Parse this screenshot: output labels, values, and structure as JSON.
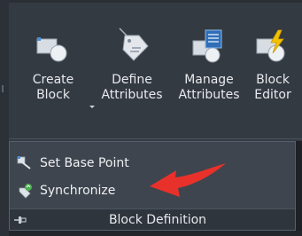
{
  "ribbon": {
    "tools": [
      {
        "line1": "Create",
        "line2": "Block",
        "icon": "create-block-icon"
      },
      {
        "line1": "Define",
        "line2": "Attributes",
        "icon": "define-attributes-icon"
      },
      {
        "line1": "Manage",
        "line2": "Attributes",
        "icon": "manage-attributes-icon"
      },
      {
        "line1": "Block",
        "line2": "Editor",
        "icon": "block-editor-icon"
      }
    ],
    "panel": {
      "items": [
        {
          "label": "Set Base Point",
          "icon": "set-base-point-icon"
        },
        {
          "label": "Synchronize",
          "icon": "synchronize-icon"
        }
      ],
      "title": "Block Definition",
      "pin_icon": "pin-icon"
    },
    "annotation_arrow_color": "#e8312b",
    "colors": {
      "panel_bg": "#343a42",
      "dropdown_bg": "#3f454e",
      "text": "#e8eaee",
      "icon_blue": "#5b9bd5",
      "icon_yellow": "#f2c200"
    }
  }
}
